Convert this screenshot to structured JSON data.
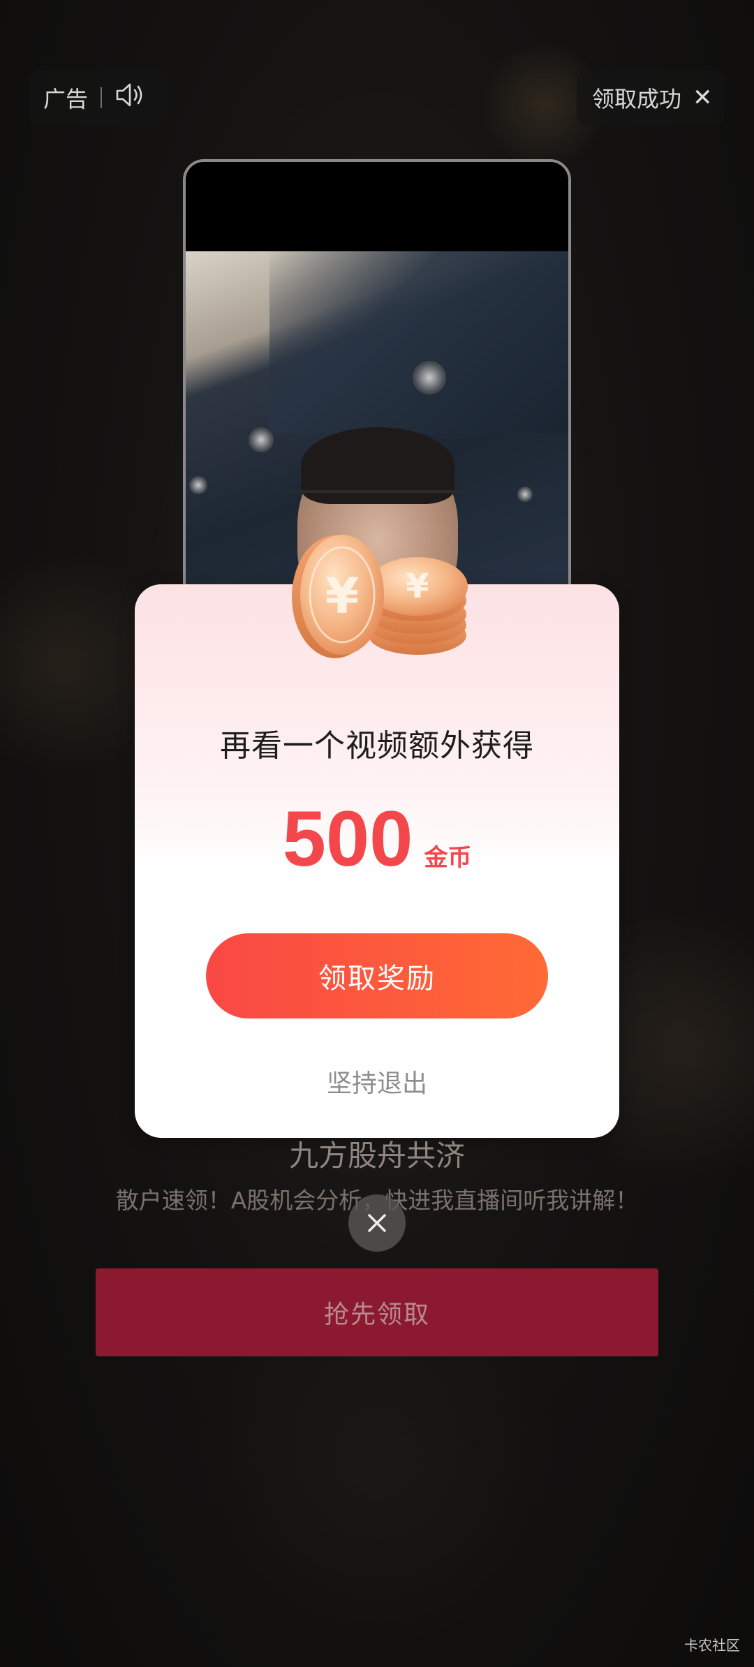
{
  "topbar": {
    "ad_label": "广告",
    "success_label": "领取成功",
    "sound_icon": "speaker-icon",
    "close_icon": "close-icon"
  },
  "modal": {
    "title": "再看一个视频额外获得",
    "amount": "500",
    "unit": "金币",
    "claim_button": "领取奖励",
    "quit_link": "坚持退出",
    "coin_icon": "gold-coins-icon"
  },
  "ad": {
    "title": "九方股舟共济",
    "subtitle": "散户速领！A股机会分析，快进我直播间听我讲解！",
    "cta": "抢先领取"
  },
  "watermark": "卡农社区",
  "colors": {
    "accent_red": "#f4474b",
    "button_gradient_start": "#f94845",
    "button_gradient_end": "#ff6a35",
    "cta_bg": "#8b1a30"
  }
}
